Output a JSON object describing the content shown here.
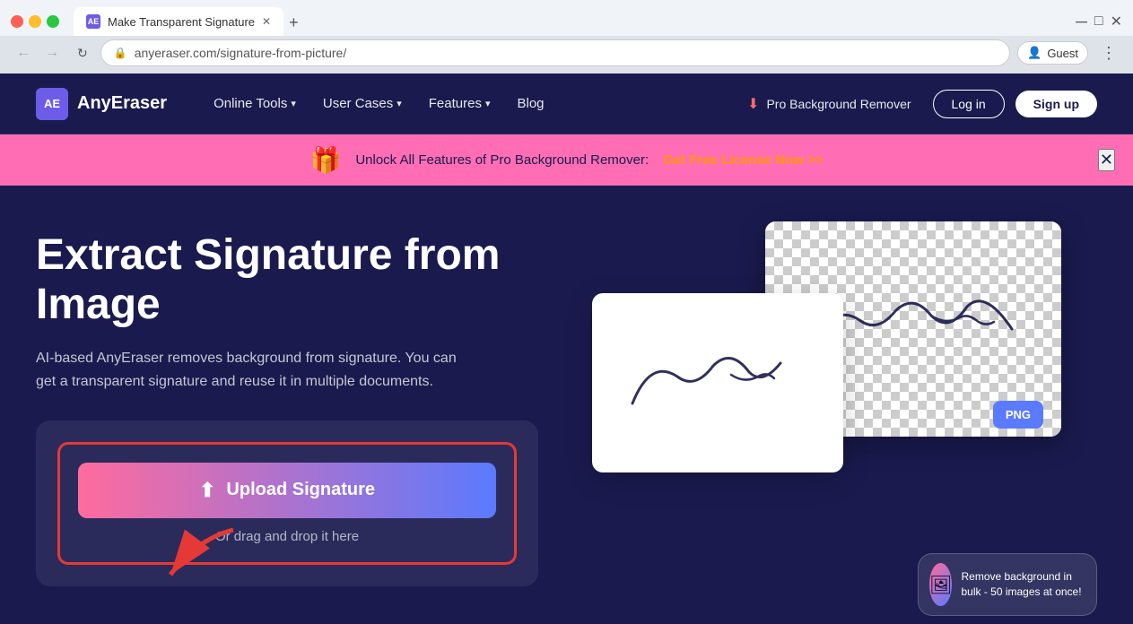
{
  "browser": {
    "tab_title": "Make Transparent Signature",
    "tab_favicon": "AE",
    "address": "anyeraser.com/signature-from-picture/",
    "profile_label": "Guest",
    "new_tab_label": "+"
  },
  "nav": {
    "logo_text": "AnyEraser",
    "logo_abbr": "AE",
    "links": [
      {
        "label": "Online Tools",
        "has_dropdown": true
      },
      {
        "label": "User Cases",
        "has_dropdown": true
      },
      {
        "label": "Features",
        "has_dropdown": true
      },
      {
        "label": "Blog",
        "has_dropdown": false
      }
    ],
    "pro_label": "Pro Background Remover",
    "login_label": "Log in",
    "signup_label": "Sign up"
  },
  "banner": {
    "text": "Unlock All Features of Pro Background Remover:",
    "cta": "Get Free License Now >>",
    "gift_emoji": "🎁"
  },
  "hero": {
    "title_line1": "Extract Signature from",
    "title_line2": "Image",
    "description": "AI-based AnyEraser removes background from signature. You can get a transparent signature and reuse it in multiple documents.",
    "upload_button_label": "Upload Signature",
    "drag_text": "Or drag and drop it here"
  },
  "bulk_card": {
    "text": "Remove background in bulk - 50 images at once!",
    "emoji": "🖼️"
  },
  "png_badge": "PNG",
  "icons": {
    "upload": "⬆",
    "gift": "🎁",
    "close": "✕",
    "arrow_down": "▾",
    "back": "←",
    "forward": "→",
    "refresh": "↻",
    "lock": "🔒",
    "user": "👤",
    "more": "⋮"
  }
}
